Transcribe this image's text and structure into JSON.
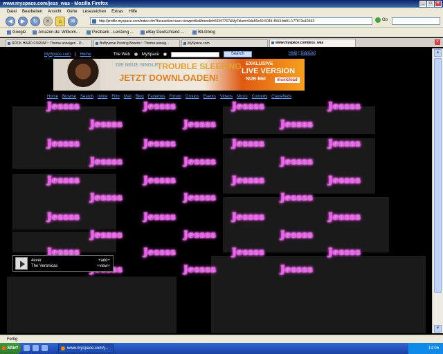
{
  "window": {
    "title": "www.myspace.com/jess_was - Mozilla Firefox",
    "controls": [
      "_",
      "□",
      "×"
    ]
  },
  "menu": [
    "Datei",
    "Bearbeiten",
    "Ansicht",
    "Gehe",
    "Lesezeichen",
    "Extras",
    "Hilfe"
  ],
  "toolbar": {
    "url": "http://profile.myspace.com/index.cfm?fuseaction=user.viewprofile&friendid=50297767&MyToken=6da56e40-6049-4553-bb91-177873a10443",
    "go_label": "Go"
  },
  "bookmarks": [
    "Google",
    "Amazon.de: Willkom...",
    "Postbank - Leistung ...",
    "eBay Deutschland -...",
    "BILDblog"
  ],
  "tabs": [
    {
      "label": "ROCK HARD FORUM :: Thema anzeigen - D...",
      "active": false
    },
    {
      "label": "Buffyverse Posting Boards :: Thema anzeig...",
      "active": false
    },
    {
      "label": "MySpace.com",
      "active": false
    },
    {
      "label": "www.myspace.com/jess_was",
      "active": true
    }
  ],
  "myspace": {
    "home_link": "MySpace.com",
    "home2": "Home",
    "web_label": "The Web",
    "myspace_label": "MySpace",
    "search_button": "Search",
    "help": "Help",
    "signout": "SignOut",
    "nav": [
      "Home",
      "Browse",
      "Search",
      "Invite",
      "Film",
      "Mail",
      "Blog",
      "Favorites",
      "Forum",
      "Groups",
      "Events",
      "Videos",
      "Music",
      "Comedy",
      "Classifieds"
    ]
  },
  "banner": {
    "line1": "DIE NEUE SINGLE",
    "line2": "TROUBLE SLEEPING",
    "line3": "JETZT DOWNLOADEN!",
    "r1": "EXKLUSIVE",
    "r2": "LIVE VERSION",
    "r3": "NUR BEI",
    "logo": "musicload"
  },
  "glitter_text": "Jessss",
  "player": {
    "song": "4ever",
    "artist": "The Veronicas",
    "add": "+add+",
    "view": "+view+"
  },
  "status": "Fertig",
  "taskbar": {
    "start": "Start",
    "item": "www.myspace.com/j...",
    "clock": "14:05"
  }
}
